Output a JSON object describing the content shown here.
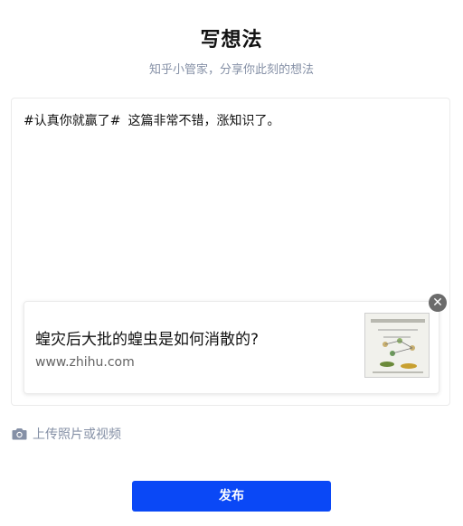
{
  "header": {
    "title": "写想法",
    "subtitle": "知乎小管家，分享你此刻的想法"
  },
  "editor": {
    "topic": "#认真你就赢了#",
    "text": "这篇非常不错，涨知识了。"
  },
  "link_card": {
    "title": "蝗灾后大批的蝗虫是如何消散的?",
    "domain": "www.zhihu.com",
    "thumbnail_icon": "article-thumbnail"
  },
  "close_icon": "close-icon",
  "upload": {
    "icon": "camera-icon",
    "label": "上传照片或视频"
  },
  "publish_button": {
    "label": "发布"
  },
  "colors": {
    "accent": "#0a48f6",
    "muted": "#8590a6"
  }
}
